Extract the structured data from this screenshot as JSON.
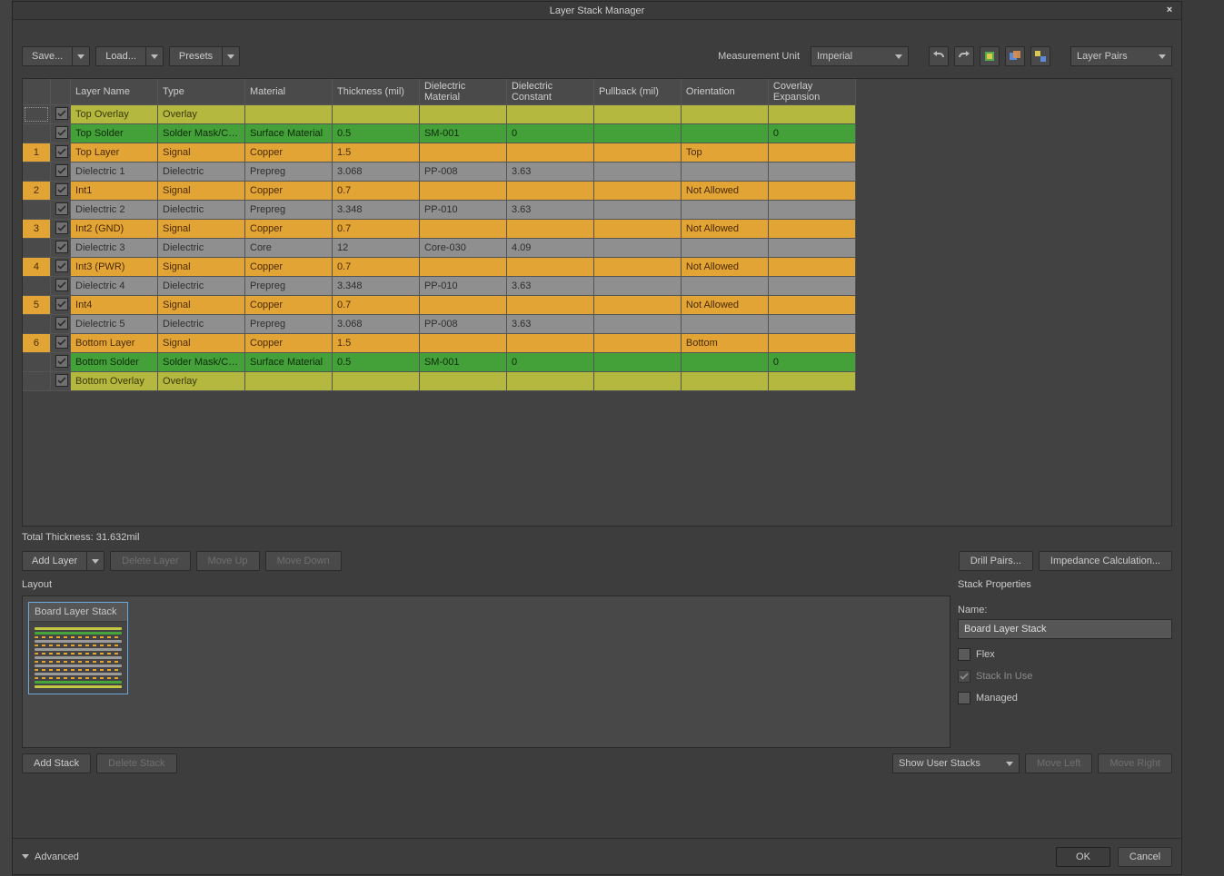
{
  "title": "Layer Stack Manager",
  "toolbar": {
    "save": "Save...",
    "load": "Load...",
    "presets": "Presets",
    "meas_label": "Measurement Unit",
    "meas_value": "Imperial",
    "layer_pairs": "Layer Pairs"
  },
  "columns": [
    "",
    "",
    "Layer Name",
    "Type",
    "Material",
    "Thickness (mil)",
    "Dielectric Material",
    "Dielectric Constant",
    "Pullback (mil)",
    "Orientation",
    "Coverlay Expansion"
  ],
  "rows": [
    {
      "cls": "r-olive first",
      "num": "",
      "name": "Top Overlay",
      "type": "Overlay",
      "mat": "",
      "thk": "",
      "dmat": "",
      "dconst": "",
      "pull": "",
      "orient": "",
      "cov": ""
    },
    {
      "cls": "r-green",
      "num": "",
      "name": "Top Solder",
      "type": "Solder Mask/Co...",
      "mat": "Surface Material",
      "thk": "0.5",
      "dmat": "SM-001",
      "dconst": "0",
      "pull": "",
      "orient": "",
      "cov": "0"
    },
    {
      "cls": "r-orange",
      "num": "1",
      "name": "Top Layer",
      "type": "Signal",
      "mat": "Copper",
      "thk": "1.5",
      "dmat": "",
      "dconst": "",
      "pull": "",
      "orient": "Top",
      "cov": ""
    },
    {
      "cls": "r-grey",
      "num": "",
      "name": "Dielectric 1",
      "type": "Dielectric",
      "mat": "Prepreg",
      "thk": "3.068",
      "dmat": "PP-008",
      "dconst": "3.63",
      "pull": "",
      "orient": "",
      "cov": ""
    },
    {
      "cls": "r-orange",
      "num": "2",
      "name": "Int1",
      "type": "Signal",
      "mat": "Copper",
      "thk": "0.7",
      "dmat": "",
      "dconst": "",
      "pull": "",
      "orient": "Not Allowed",
      "cov": ""
    },
    {
      "cls": "r-grey",
      "num": "",
      "name": "Dielectric 2",
      "type": "Dielectric",
      "mat": "Prepreg",
      "thk": "3.348",
      "dmat": "PP-010",
      "dconst": "3.63",
      "pull": "",
      "orient": "",
      "cov": ""
    },
    {
      "cls": "r-orange",
      "num": "3",
      "name": "Int2 (GND)",
      "type": "Signal",
      "mat": "Copper",
      "thk": "0.7",
      "dmat": "",
      "dconst": "",
      "pull": "",
      "orient": "Not Allowed",
      "cov": ""
    },
    {
      "cls": "r-grey",
      "num": "",
      "name": "Dielectric 3",
      "type": "Dielectric",
      "mat": "Core",
      "thk": "12",
      "dmat": "Core-030",
      "dconst": "4.09",
      "pull": "",
      "orient": "",
      "cov": ""
    },
    {
      "cls": "r-orange",
      "num": "4",
      "name": "Int3 (PWR)",
      "type": "Signal",
      "mat": "Copper",
      "thk": "0.7",
      "dmat": "",
      "dconst": "",
      "pull": "",
      "orient": "Not Allowed",
      "cov": ""
    },
    {
      "cls": "r-grey",
      "num": "",
      "name": "Dielectric 4",
      "type": "Dielectric",
      "mat": "Prepreg",
      "thk": "3.348",
      "dmat": "PP-010",
      "dconst": "3.63",
      "pull": "",
      "orient": "",
      "cov": ""
    },
    {
      "cls": "r-orange",
      "num": "5",
      "name": "Int4",
      "type": "Signal",
      "mat": "Copper",
      "thk": "0.7",
      "dmat": "",
      "dconst": "",
      "pull": "",
      "orient": "Not Allowed",
      "cov": ""
    },
    {
      "cls": "r-grey",
      "num": "",
      "name": "Dielectric 5",
      "type": "Dielectric",
      "mat": "Prepreg",
      "thk": "3.068",
      "dmat": "PP-008",
      "dconst": "3.63",
      "pull": "",
      "orient": "",
      "cov": ""
    },
    {
      "cls": "r-orange",
      "num": "6",
      "name": "Bottom Layer",
      "type": "Signal",
      "mat": "Copper",
      "thk": "1.5",
      "dmat": "",
      "dconst": "",
      "pull": "",
      "orient": "Bottom",
      "cov": ""
    },
    {
      "cls": "r-green",
      "num": "",
      "name": "Bottom Solder",
      "type": "Solder Mask/Co...",
      "mat": "Surface Material",
      "thk": "0.5",
      "dmat": "SM-001",
      "dconst": "0",
      "pull": "",
      "orient": "",
      "cov": "0"
    },
    {
      "cls": "r-olive",
      "num": "",
      "name": "Bottom Overlay",
      "type": "Overlay",
      "mat": "",
      "thk": "",
      "dmat": "",
      "dconst": "",
      "pull": "",
      "orient": "",
      "cov": ""
    }
  ],
  "total_thickness": "Total Thickness: 31.632mil",
  "mid": {
    "add_layer": "Add Layer",
    "delete_layer": "Delete Layer",
    "move_up": "Move Up",
    "move_down": "Move Down",
    "drill_pairs": "Drill Pairs...",
    "impedance": "Impedance Calculation..."
  },
  "layout": {
    "title": "Layout",
    "chip_title": "Board Layer Stack"
  },
  "props": {
    "title": "Stack Properties",
    "name_label": "Name:",
    "name_value": "Board Layer Stack",
    "flex": "Flex",
    "stack_in_use": "Stack In Use",
    "managed": "Managed"
  },
  "bottom": {
    "add_stack": "Add Stack",
    "delete_stack": "Delete Stack",
    "show_user": "Show User Stacks",
    "move_left": "Move Left",
    "move_right": "Move Right"
  },
  "footer": {
    "advanced": "Advanced",
    "ok": "OK",
    "cancel": "Cancel"
  }
}
